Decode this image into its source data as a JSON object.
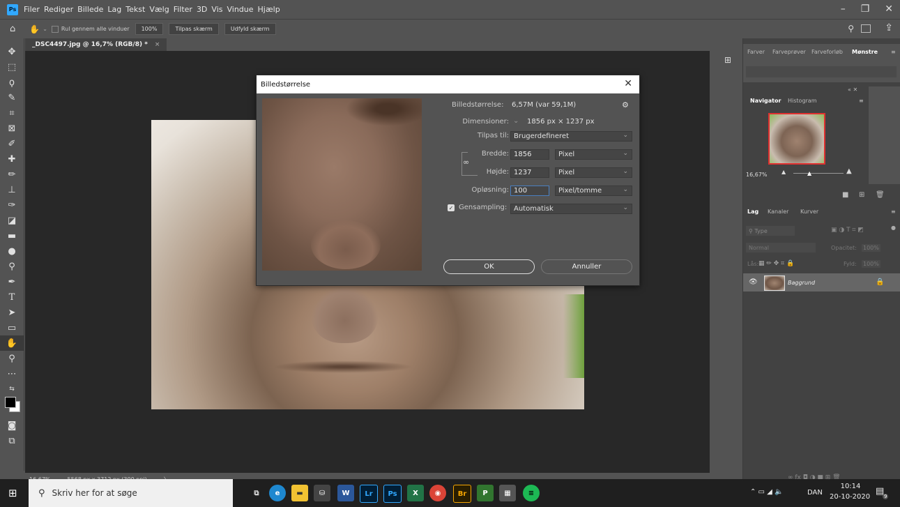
{
  "menubar": {
    "app_logo": "Ps",
    "items": [
      "Filer",
      "Rediger",
      "Billede",
      "Lag",
      "Tekst",
      "Vælg",
      "Filter",
      "3D",
      "Vis",
      "Vindue",
      "Hjælp"
    ]
  },
  "options_bar": {
    "scroll_all": "Rul gennem alle vinduer",
    "zoom_100": "100%",
    "fit_screen": "Tilpas skærm",
    "fill_screen": "Udfyld skærm"
  },
  "document": {
    "tab_title": "_DSC4497.jpg @ 16,7% (RGB/8) *",
    "status_zoom": "16,67%",
    "status_info": "5568 px x 3712 px (300 ppi)"
  },
  "dialog": {
    "title": "Billedstørrelse",
    "image_size_label": "Billedstørrelse:",
    "image_size_value": "6,57M (var 59,1M)",
    "dimensions_label": "Dimensioner:",
    "dimensions_value": "1856 px  ×  1237 px",
    "fit_to_label": "Tilpas til:",
    "fit_to_value": "Brugerdefineret",
    "width_label": "Bredde:",
    "width_value": "1856",
    "width_unit": "Pixel",
    "height_label": "Højde:",
    "height_value": "1237",
    "height_unit": "Pixel",
    "resolution_label": "Opløsning:",
    "resolution_value": "100",
    "resolution_unit": "Pixel/tomme",
    "resample_label": "Gensampling:",
    "resample_value": "Automatisk",
    "ok": "OK",
    "cancel": "Annuller"
  },
  "panels": {
    "top_tabs": [
      "Farver",
      "Farveprøver",
      "Farveforløb",
      "Mønstre"
    ],
    "nav_tabs": [
      "Navigator",
      "Histogram"
    ],
    "nav_zoom": "16,67%",
    "layer_tabs": [
      "Lag",
      "Kanaler",
      "Kurver"
    ],
    "layer_filter": "Type",
    "blend_mode": "Normal",
    "opacity_label": "Opacitet:",
    "opacity_value": "100%",
    "lock_label": "Lås:",
    "fill_label": "Fyld:",
    "fill_value": "100%",
    "layer_name": "Baggrund"
  },
  "taskbar": {
    "search_placeholder": "Skriv her for at søge",
    "language": "DAN",
    "time": "10:14",
    "date": "20-10-2020",
    "notifications": "9",
    "apps": [
      "task-view",
      "edge",
      "file-explorer",
      "store",
      "word",
      "lightroom",
      "photoshop",
      "excel",
      "chrome",
      "bridge",
      "project",
      "calculator",
      "spotify"
    ]
  },
  "colors": {
    "ps_blue": "#31a8ff",
    "panel_dark": "#424242",
    "panel": "#535353",
    "canvas": "#282828"
  }
}
